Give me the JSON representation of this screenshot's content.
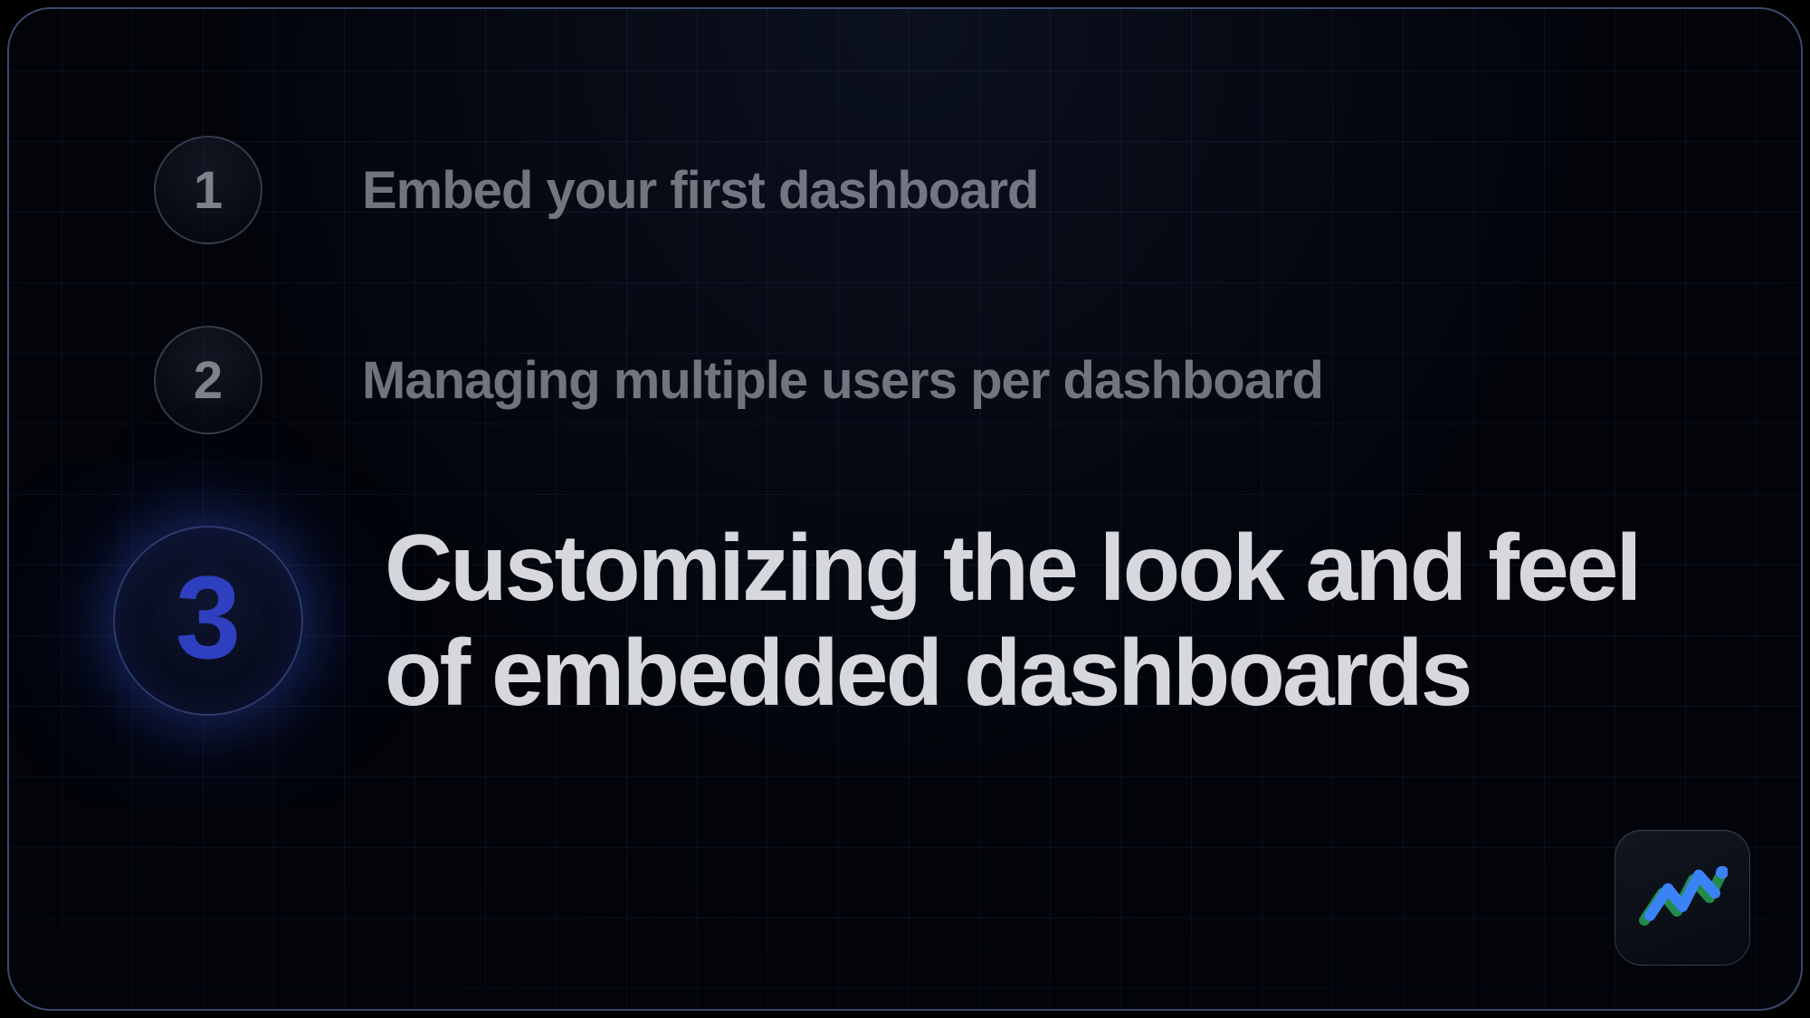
{
  "steps": [
    {
      "number": "1",
      "label": "Embed your first dashboard",
      "active": false
    },
    {
      "number": "2",
      "label": "Managing multiple users per dashboard",
      "active": false
    },
    {
      "number": "3",
      "label": "Customizing the look and feel of embedded dashboards",
      "active": true
    }
  ],
  "logo": {
    "name": "metabase-logo"
  }
}
